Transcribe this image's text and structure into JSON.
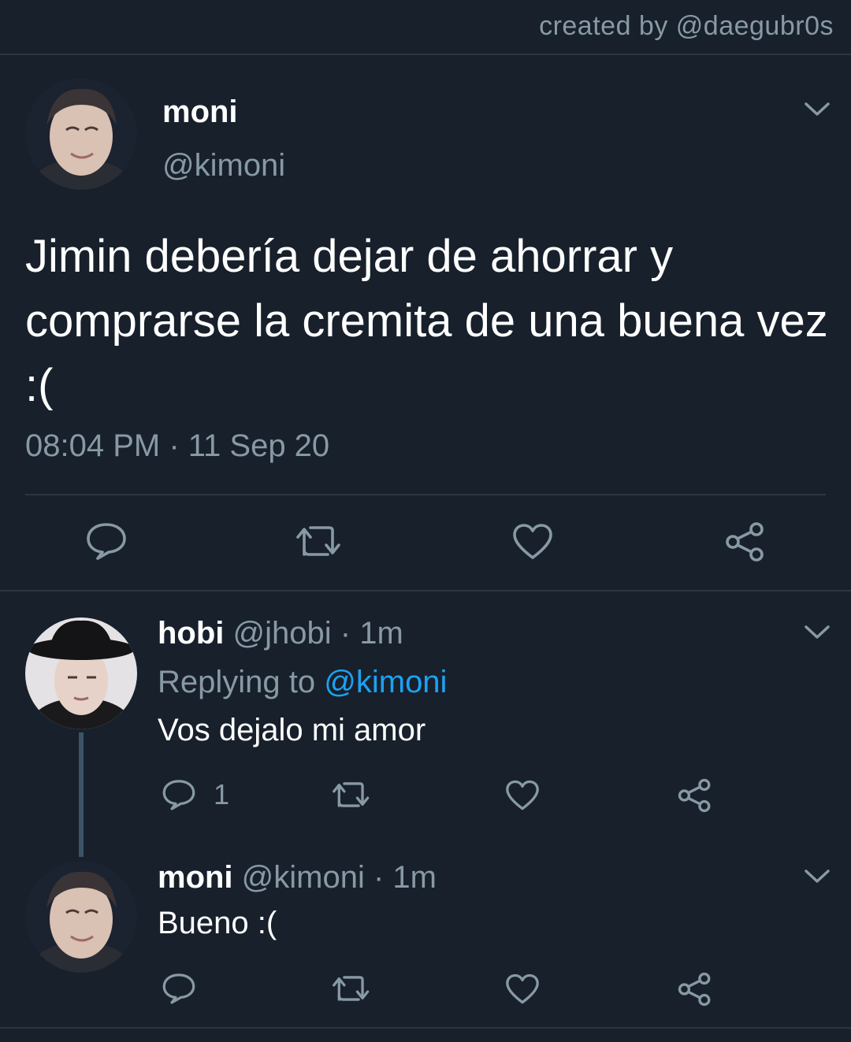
{
  "credit": "created by @daegubr0s",
  "main_tweet": {
    "name": "moni",
    "handle": "@kimoni",
    "text": "Jimin debería dejar de ahorrar y comprarse la cremita de una buena vez :(",
    "timestamp": "08:04 PM · 11 Sep 20",
    "avatar_icon": "user-avatar-icon"
  },
  "replies": [
    {
      "name": "hobi",
      "handle": "@jhobi",
      "time": "· 1m",
      "replying_prefix": "Replying to",
      "replying_to": "@kimoni",
      "text": "Vos dejalo mi amor",
      "reply_count": "1"
    },
    {
      "name": "moni",
      "handle": "@kimoni",
      "time": "· 1m",
      "text": "Bueno :("
    }
  ],
  "colors": {
    "background": "#17202b",
    "muted_text": "#8899a6",
    "link": "#1da1f2",
    "divider": "#2b3641"
  }
}
